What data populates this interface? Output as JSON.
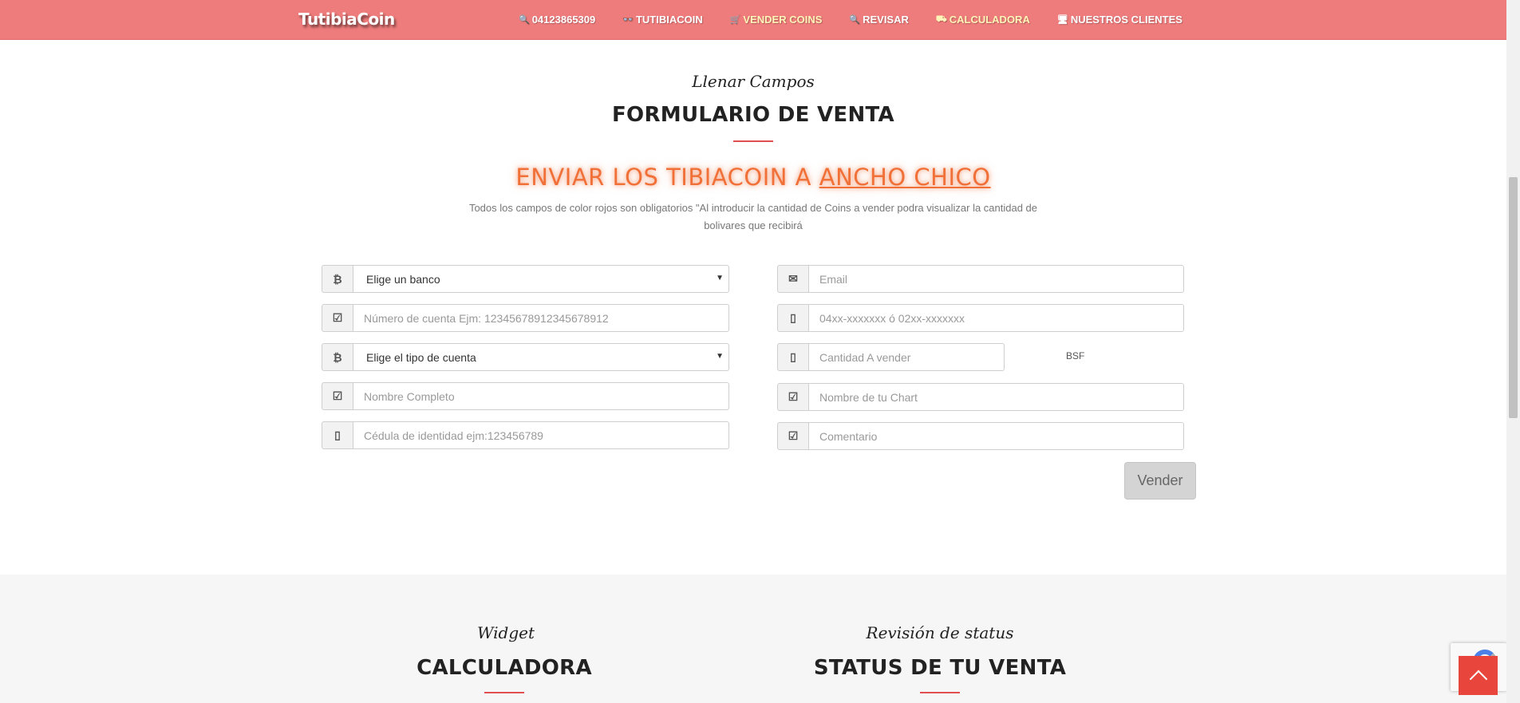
{
  "navbar": {
    "brand": "TutibiaCoin",
    "links": [
      {
        "icon": "🔍",
        "icon_name": "search-icon",
        "label": "04123865309",
        "active": false
      },
      {
        "icon": "👓",
        "icon_name": "glasses-icon",
        "label": "TUTIBIACOIN",
        "active": false
      },
      {
        "icon": "🛒",
        "icon_name": "cart-icon",
        "label": "VENDER COINS",
        "active": true
      },
      {
        "icon": "🔍",
        "icon_name": "search-icon",
        "label": "REVISAR",
        "active": false
      },
      {
        "icon": "⛟",
        "icon_name": "calculator-icon",
        "label": "CALCULADORA",
        "active": true
      },
      {
        "icon": "🖥",
        "icon_name": "desktop-icon",
        "label": "NUESTROS CLIENTES",
        "active": false
      }
    ],
    "accent_color": "#ef7c7c"
  },
  "form_section": {
    "script_title": "Llenar Campos",
    "title": "FORMULARIO DE VENTA",
    "send_heading_prefix": "ENVIAR LOS TIBIACOIN A ",
    "send_heading_target": "ANCHO CHICO",
    "notice": "Todos los campos de color rojos son obligatorios \"Al introducir la cantidad de Coins a vender podra visualizar la cantidad de bolivares que recibirá",
    "left_fields": [
      {
        "icon": "bitcoin-icon",
        "type": "select",
        "value": "Elige un banco"
      },
      {
        "icon": "edit-icon",
        "type": "input",
        "placeholder": "Número de cuenta Ejm: 12345678912345678912"
      },
      {
        "icon": "bitcoin-icon",
        "type": "select",
        "value": "Elige el tipo de cuenta"
      },
      {
        "icon": "edit-icon",
        "type": "input",
        "placeholder": "Nombre Completo"
      },
      {
        "icon": "phone-icon",
        "type": "input",
        "placeholder": "Cédula de identidad ejm:123456789"
      }
    ],
    "right_fields": [
      {
        "icon": "envelope-icon",
        "type": "input",
        "placeholder": "Email"
      },
      {
        "icon": "phone-icon",
        "type": "input",
        "placeholder": "04xx-xxxxxxx ó 02xx-xxxxxxx"
      },
      {
        "icon": "phone-icon",
        "type": "input",
        "placeholder": "Cantidad A vender"
      },
      {
        "icon": "edit-icon",
        "type": "input",
        "placeholder": "Nombre de tu Chart"
      },
      {
        "icon": "edit-icon",
        "type": "input",
        "placeholder": "Comentario"
      }
    ],
    "unit_label": "BSF",
    "submit_label": "Vender"
  },
  "lower_section": {
    "widget_script": "Widget",
    "widget_title": "CALCULADORA",
    "status_script": "Revisión de status",
    "status_title": "STATUS DE TU VENTA"
  }
}
